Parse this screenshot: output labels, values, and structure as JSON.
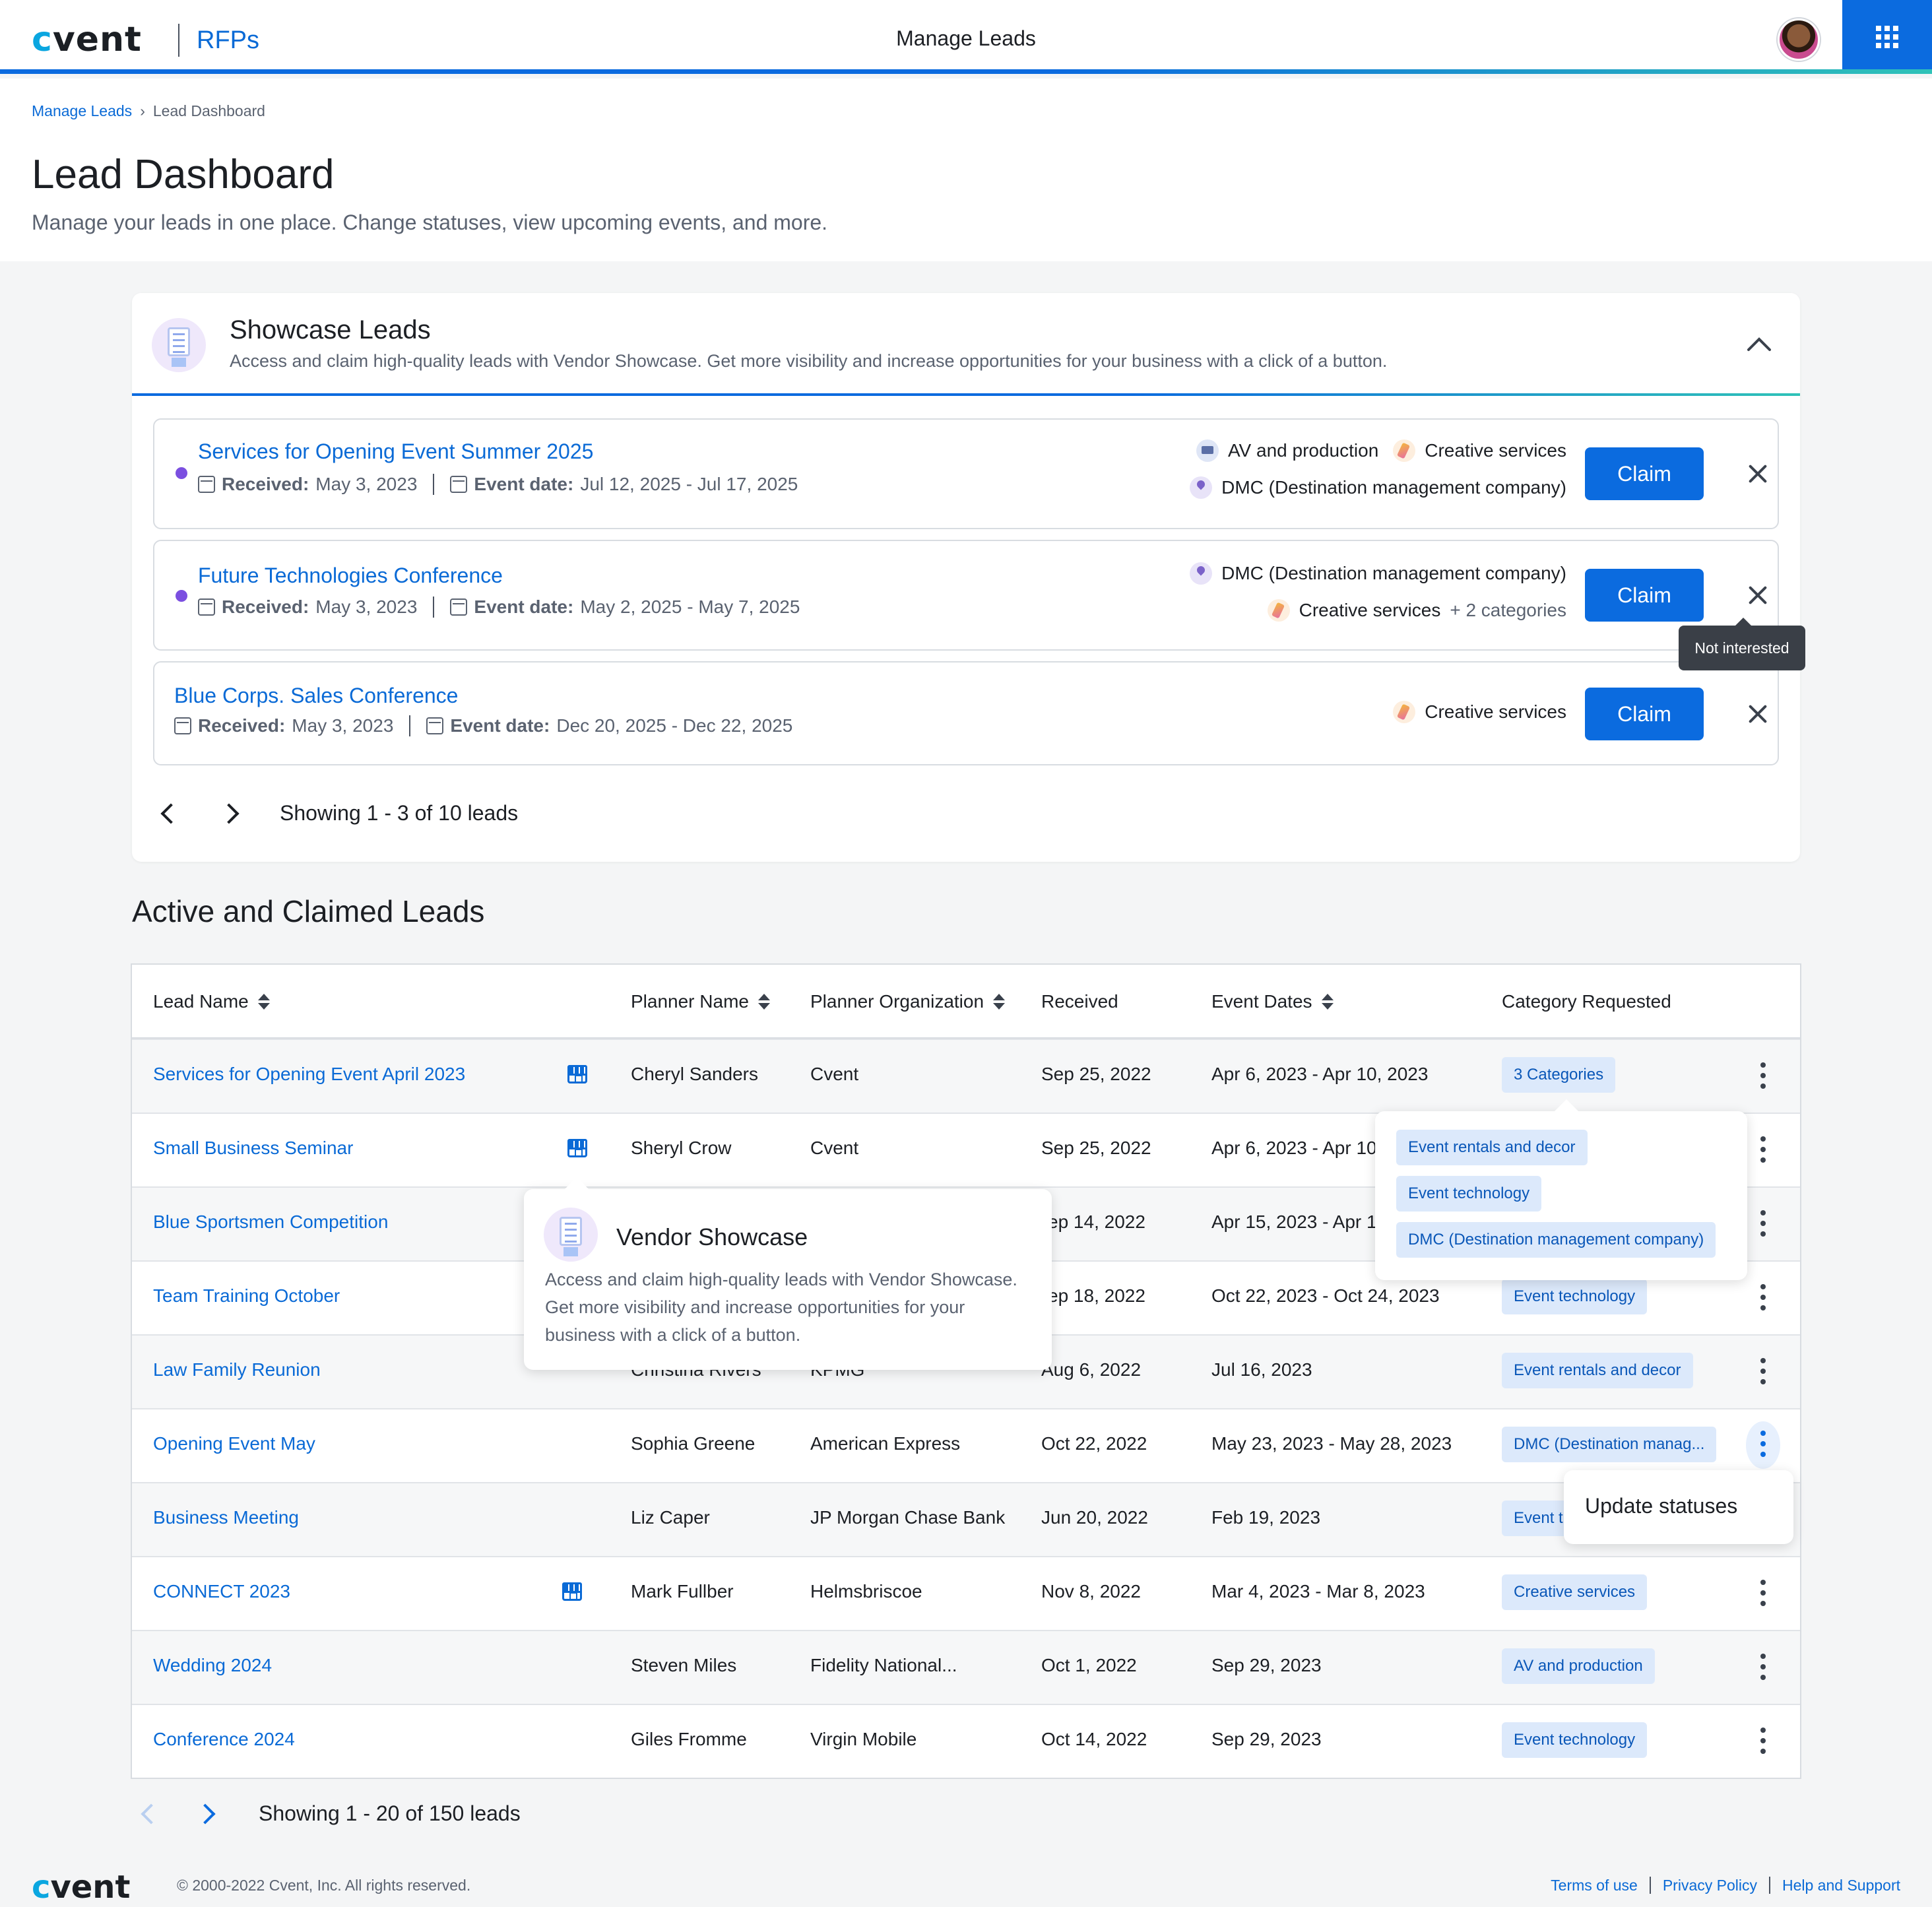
{
  "header": {
    "logo": "cvent",
    "app_name": "RFPs",
    "page_label": "Manage Leads"
  },
  "breadcrumb": {
    "parent": "Manage Leads",
    "current": "Lead Dashboard"
  },
  "page": {
    "title": "Lead Dashboard",
    "subtitle": "Manage your leads in one place. Change statuses, view upcoming events, and more."
  },
  "showcase": {
    "title": "Showcase Leads",
    "description": "Access and claim high-quality leads with Vendor Showcase. Get more visibility and increase opportunities for your business with a click of a button.",
    "received_label": "Received:",
    "event_date_label": "Event date:",
    "claim_label": "Claim",
    "leads": [
      {
        "name": "Services for Opening Event Summer 2025",
        "received": "May 3, 2023",
        "event_date": "Jul 12, 2025 - Jul 17, 2025",
        "cat1": "AV and production",
        "cat2": "Creative services",
        "cat3": "DMC (Destination management company)"
      },
      {
        "name": "Future Technologies Conference",
        "received": "May 3, 2023",
        "event_date": "May 2, 2025 - May 7, 2025",
        "cat1": "DMC (Destination management company)",
        "cat2": "Creative services",
        "more": "+ 2 categories"
      },
      {
        "name": "Blue Corps. Sales Conference",
        "received": "May 3, 2023",
        "event_date": "Dec 20, 2025 - Dec 22, 2025",
        "cat1": "Creative services"
      }
    ],
    "tooltip": "Not interested",
    "pager": "Showing 1 - 3 of 10 leads"
  },
  "active": {
    "title": "Active and Claimed Leads",
    "columns": [
      "Lead Name",
      "Planner Name",
      "Planner Organization",
      "Received",
      "Event Dates",
      "Category Requested"
    ],
    "rows": [
      {
        "name": "Services for Opening Event April 2023",
        "planner": "Cheryl Sanders",
        "org": "Cvent",
        "received": "Sep 25, 2022",
        "dates": "Apr 6, 2023 - Apr 10, 2023",
        "category": "3 Categories"
      },
      {
        "name": "Small Business Seminar",
        "planner": "Sheryl Crow",
        "org": "Cvent",
        "received": "Sep 25, 2022",
        "dates": "Apr 6, 2023 - Apr 10",
        "category": ""
      },
      {
        "name": "Blue Sportsmen Competition",
        "planner": "",
        "org": "",
        "received": "ep 14, 2022",
        "dates": "Apr 15, 2023 - Apr 1",
        "category": ""
      },
      {
        "name": "Team Training October",
        "planner": "",
        "org": "",
        "received": "ep 18, 2022",
        "dates": "Oct 22, 2023 - Oct 24, 2023",
        "category": "Event technology"
      },
      {
        "name": "Law Family Reunion",
        "planner": "Christina Rivers",
        "org": "KPMG",
        "received": "Aug 6, 2022",
        "dates": "Jul 16, 2023",
        "category": "Event rentals and decor"
      },
      {
        "name": "Opening Event May",
        "planner": "Sophia Greene",
        "org": "American Express",
        "received": "Oct 22, 2022",
        "dates": "May 23, 2023 - May 28, 2023",
        "category": "DMC (Destination manag..."
      },
      {
        "name": "Business Meeting",
        "planner": "Liz Caper",
        "org": "JP Morgan Chase Bank",
        "received": "Jun 20, 2022",
        "dates": "Feb 19, 2023",
        "category": "Event t"
      },
      {
        "name": "CONNECT 2023",
        "planner": "Mark Fullber",
        "org": "Helmsbriscoe",
        "received": "Nov 8, 2022",
        "dates": "Mar 4, 2023 - Mar 8, 2023",
        "category": "Creative services"
      },
      {
        "name": "Wedding 2024",
        "planner": "Steven Miles",
        "org": "Fidelity National...",
        "received": "Oct 1, 2022",
        "dates": "Sep 29, 2023",
        "category": "AV and production"
      },
      {
        "name": "Conference 2024",
        "planner": "Giles Fromme",
        "org": "Virgin Mobile",
        "received": "Oct 14, 2022",
        "dates": "Sep 29, 2023",
        "category": "Event technology"
      }
    ],
    "category_popover": [
      "Event rentals and decor",
      "Event technology",
      "DMC (Destination management company)"
    ],
    "vendor_popover": {
      "title": "Vendor Showcase",
      "description": "Access and claim high-quality leads with Vendor Showcase. Get more visibility and increase opportunities for your business with a click of a button."
    },
    "menu": {
      "update_statuses": "Update statuses"
    },
    "pager": "Showing 1 - 20 of 150 leads"
  },
  "footer": {
    "logo": "cvent",
    "copyright": "© 2000-2022 Cvent, Inc. All rights reserved.",
    "links": [
      "Terms of use",
      "Privacy Policy",
      "Help and Support"
    ]
  },
  "colors": {
    "primary": "#0b6bdf",
    "link": "#0a6ad6",
    "badge_bg": "#dce9fb",
    "accent_gradient_end": "#2fc2b8",
    "unread_dot": "#7b4fe0"
  },
  "icons": [
    "apps-grid-icon",
    "chevron-up-icon",
    "calendar-icon",
    "close-icon",
    "chevron-left-icon",
    "chevron-right-icon",
    "sort-icon",
    "storefront-icon",
    "kebab-icon"
  ]
}
